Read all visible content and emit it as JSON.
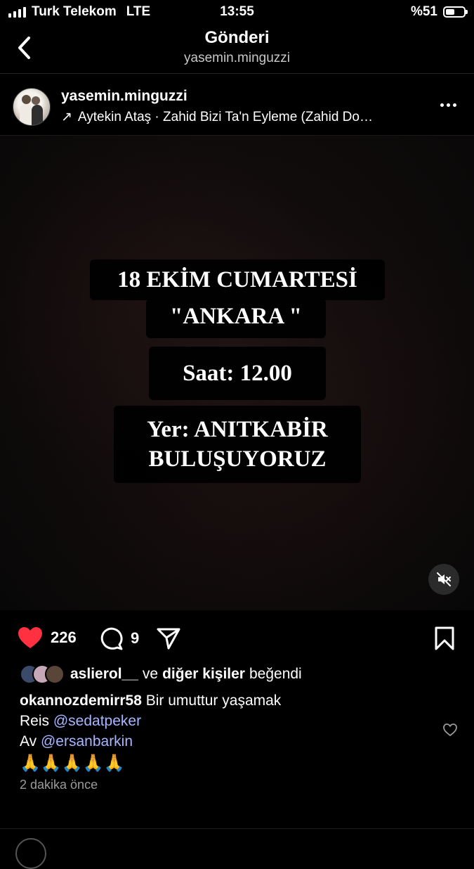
{
  "status_bar": {
    "carrier": "Turk Telekom",
    "network": "LTE",
    "time": "13:55",
    "battery_text": "%51",
    "battery_level": 0.51
  },
  "nav": {
    "title": "Gönderi",
    "subtitle": "yasemin.minguzzi"
  },
  "post": {
    "username": "yasemin.minguzzi",
    "music_arrow": "↗",
    "music": "Aytekin Ataş · Zahid Bizi Ta'n Eyleme (Zahid Do…",
    "overlay": {
      "line1": "18 EKİM CUMARTESİ",
      "line2": "\"ANKARA \"",
      "line3": "Saat: 12.00",
      "line4": "Yer: ANITKABİR",
      "line5": "BULUŞUYORUZ"
    }
  },
  "actions": {
    "like_count": "226",
    "comment_count": "9"
  },
  "likes": {
    "user": "aslierol__",
    "connector": "ve",
    "others": "diğer kişiler",
    "verb": "beğendi"
  },
  "caption": {
    "author": "okannozdemirr58",
    "text": "Bir umuttur yaşamak",
    "line2_prefix": "Reis",
    "mention1": "@sedatpeker",
    "line3_prefix": "Av",
    "mention2": "@ersanbarkin",
    "emojis": "🙏🙏🙏🙏🙏"
  },
  "time_ago": "2 dakika önce",
  "colors": {
    "like": "#ff3040",
    "mention": "#a7b6ff",
    "background": "#000000"
  },
  "icons": [
    "back-chevron-icon",
    "more-icon",
    "heart-filled-icon",
    "comment-icon",
    "share-icon",
    "bookmark-icon",
    "mute-icon",
    "heart-outline-icon"
  ]
}
